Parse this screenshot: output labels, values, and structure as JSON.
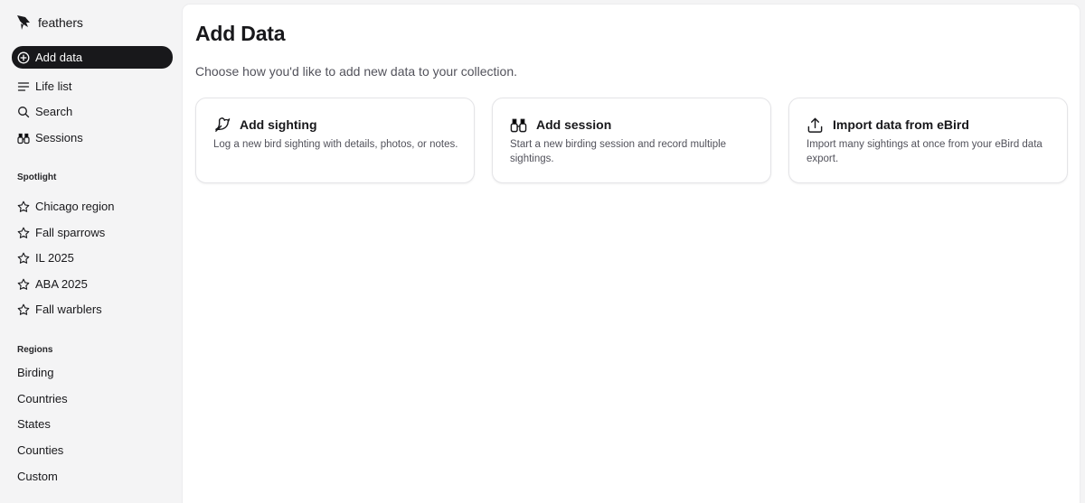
{
  "app": {
    "name": "feathers"
  },
  "nav": {
    "items": [
      {
        "label": "Add data",
        "active": true,
        "icon": "plus-circle-icon"
      },
      {
        "label": "Life list",
        "icon": "list-icon"
      },
      {
        "label": "Search",
        "icon": "search-icon"
      },
      {
        "label": "Sessions",
        "icon": "binoculars-icon"
      }
    ]
  },
  "spotlight": {
    "label": "Spotlight",
    "items": [
      "Chicago region",
      "Fall sparrows",
      "IL 2025",
      "ABA 2025",
      "Fall warblers"
    ]
  },
  "regions": {
    "label": "Regions",
    "items": [
      "Birding",
      "Countries",
      "States",
      "Counties",
      "Custom"
    ]
  },
  "main": {
    "title": "Add Data",
    "subtitle": "Choose how you'd like to add new data to your collection.",
    "cards": [
      {
        "title": "Add sighting",
        "description": "Log a new bird sighting with details, photos, or notes.",
        "icon": "bird-icon"
      },
      {
        "title": "Add session",
        "description": "Start a new birding session and record multiple sightings.",
        "icon": "binoculars-icon"
      },
      {
        "title": "Import data from eBird",
        "description": "Import many sightings at once from your eBird data export.",
        "icon": "upload-icon"
      }
    ]
  }
}
